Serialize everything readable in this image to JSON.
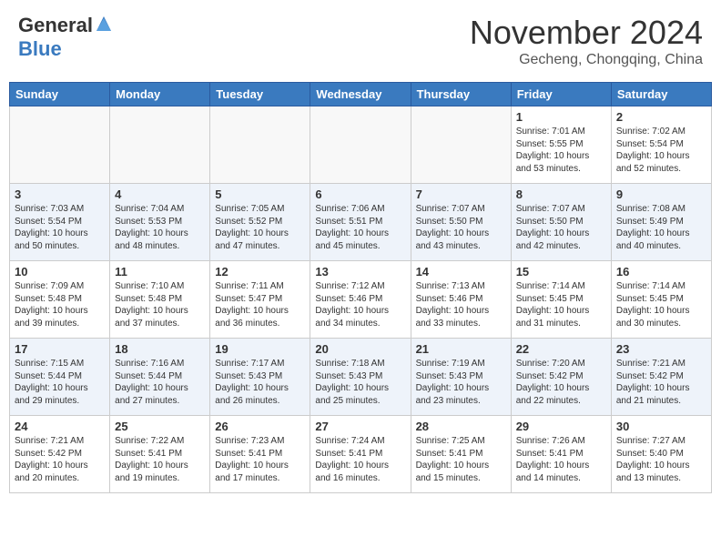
{
  "header": {
    "logo_general": "General",
    "logo_blue": "Blue",
    "month_title": "November 2024",
    "subtitle": "Gecheng, Chongqing, China"
  },
  "weekdays": [
    "Sunday",
    "Monday",
    "Tuesday",
    "Wednesday",
    "Thursday",
    "Friday",
    "Saturday"
  ],
  "weeks": [
    {
      "days": [
        {
          "date": "",
          "info": ""
        },
        {
          "date": "",
          "info": ""
        },
        {
          "date": "",
          "info": ""
        },
        {
          "date": "",
          "info": ""
        },
        {
          "date": "",
          "info": ""
        },
        {
          "date": "1",
          "info": "Sunrise: 7:01 AM\nSunset: 5:55 PM\nDaylight: 10 hours\nand 53 minutes."
        },
        {
          "date": "2",
          "info": "Sunrise: 7:02 AM\nSunset: 5:54 PM\nDaylight: 10 hours\nand 52 minutes."
        }
      ]
    },
    {
      "days": [
        {
          "date": "3",
          "info": "Sunrise: 7:03 AM\nSunset: 5:54 PM\nDaylight: 10 hours\nand 50 minutes."
        },
        {
          "date": "4",
          "info": "Sunrise: 7:04 AM\nSunset: 5:53 PM\nDaylight: 10 hours\nand 48 minutes."
        },
        {
          "date": "5",
          "info": "Sunrise: 7:05 AM\nSunset: 5:52 PM\nDaylight: 10 hours\nand 47 minutes."
        },
        {
          "date": "6",
          "info": "Sunrise: 7:06 AM\nSunset: 5:51 PM\nDaylight: 10 hours\nand 45 minutes."
        },
        {
          "date": "7",
          "info": "Sunrise: 7:07 AM\nSunset: 5:50 PM\nDaylight: 10 hours\nand 43 minutes."
        },
        {
          "date": "8",
          "info": "Sunrise: 7:07 AM\nSunset: 5:50 PM\nDaylight: 10 hours\nand 42 minutes."
        },
        {
          "date": "9",
          "info": "Sunrise: 7:08 AM\nSunset: 5:49 PM\nDaylight: 10 hours\nand 40 minutes."
        }
      ]
    },
    {
      "days": [
        {
          "date": "10",
          "info": "Sunrise: 7:09 AM\nSunset: 5:48 PM\nDaylight: 10 hours\nand 39 minutes."
        },
        {
          "date": "11",
          "info": "Sunrise: 7:10 AM\nSunset: 5:48 PM\nDaylight: 10 hours\nand 37 minutes."
        },
        {
          "date": "12",
          "info": "Sunrise: 7:11 AM\nSunset: 5:47 PM\nDaylight: 10 hours\nand 36 minutes."
        },
        {
          "date": "13",
          "info": "Sunrise: 7:12 AM\nSunset: 5:46 PM\nDaylight: 10 hours\nand 34 minutes."
        },
        {
          "date": "14",
          "info": "Sunrise: 7:13 AM\nSunset: 5:46 PM\nDaylight: 10 hours\nand 33 minutes."
        },
        {
          "date": "15",
          "info": "Sunrise: 7:14 AM\nSunset: 5:45 PM\nDaylight: 10 hours\nand 31 minutes."
        },
        {
          "date": "16",
          "info": "Sunrise: 7:14 AM\nSunset: 5:45 PM\nDaylight: 10 hours\nand 30 minutes."
        }
      ]
    },
    {
      "days": [
        {
          "date": "17",
          "info": "Sunrise: 7:15 AM\nSunset: 5:44 PM\nDaylight: 10 hours\nand 29 minutes."
        },
        {
          "date": "18",
          "info": "Sunrise: 7:16 AM\nSunset: 5:44 PM\nDaylight: 10 hours\nand 27 minutes."
        },
        {
          "date": "19",
          "info": "Sunrise: 7:17 AM\nSunset: 5:43 PM\nDaylight: 10 hours\nand 26 minutes."
        },
        {
          "date": "20",
          "info": "Sunrise: 7:18 AM\nSunset: 5:43 PM\nDaylight: 10 hours\nand 25 minutes."
        },
        {
          "date": "21",
          "info": "Sunrise: 7:19 AM\nSunset: 5:43 PM\nDaylight: 10 hours\nand 23 minutes."
        },
        {
          "date": "22",
          "info": "Sunrise: 7:20 AM\nSunset: 5:42 PM\nDaylight: 10 hours\nand 22 minutes."
        },
        {
          "date": "23",
          "info": "Sunrise: 7:21 AM\nSunset: 5:42 PM\nDaylight: 10 hours\nand 21 minutes."
        }
      ]
    },
    {
      "days": [
        {
          "date": "24",
          "info": "Sunrise: 7:21 AM\nSunset: 5:42 PM\nDaylight: 10 hours\nand 20 minutes."
        },
        {
          "date": "25",
          "info": "Sunrise: 7:22 AM\nSunset: 5:41 PM\nDaylight: 10 hours\nand 19 minutes."
        },
        {
          "date": "26",
          "info": "Sunrise: 7:23 AM\nSunset: 5:41 PM\nDaylight: 10 hours\nand 17 minutes."
        },
        {
          "date": "27",
          "info": "Sunrise: 7:24 AM\nSunset: 5:41 PM\nDaylight: 10 hours\nand 16 minutes."
        },
        {
          "date": "28",
          "info": "Sunrise: 7:25 AM\nSunset: 5:41 PM\nDaylight: 10 hours\nand 15 minutes."
        },
        {
          "date": "29",
          "info": "Sunrise: 7:26 AM\nSunset: 5:41 PM\nDaylight: 10 hours\nand 14 minutes."
        },
        {
          "date": "30",
          "info": "Sunrise: 7:27 AM\nSunset: 5:40 PM\nDaylight: 10 hours\nand 13 minutes."
        }
      ]
    }
  ]
}
